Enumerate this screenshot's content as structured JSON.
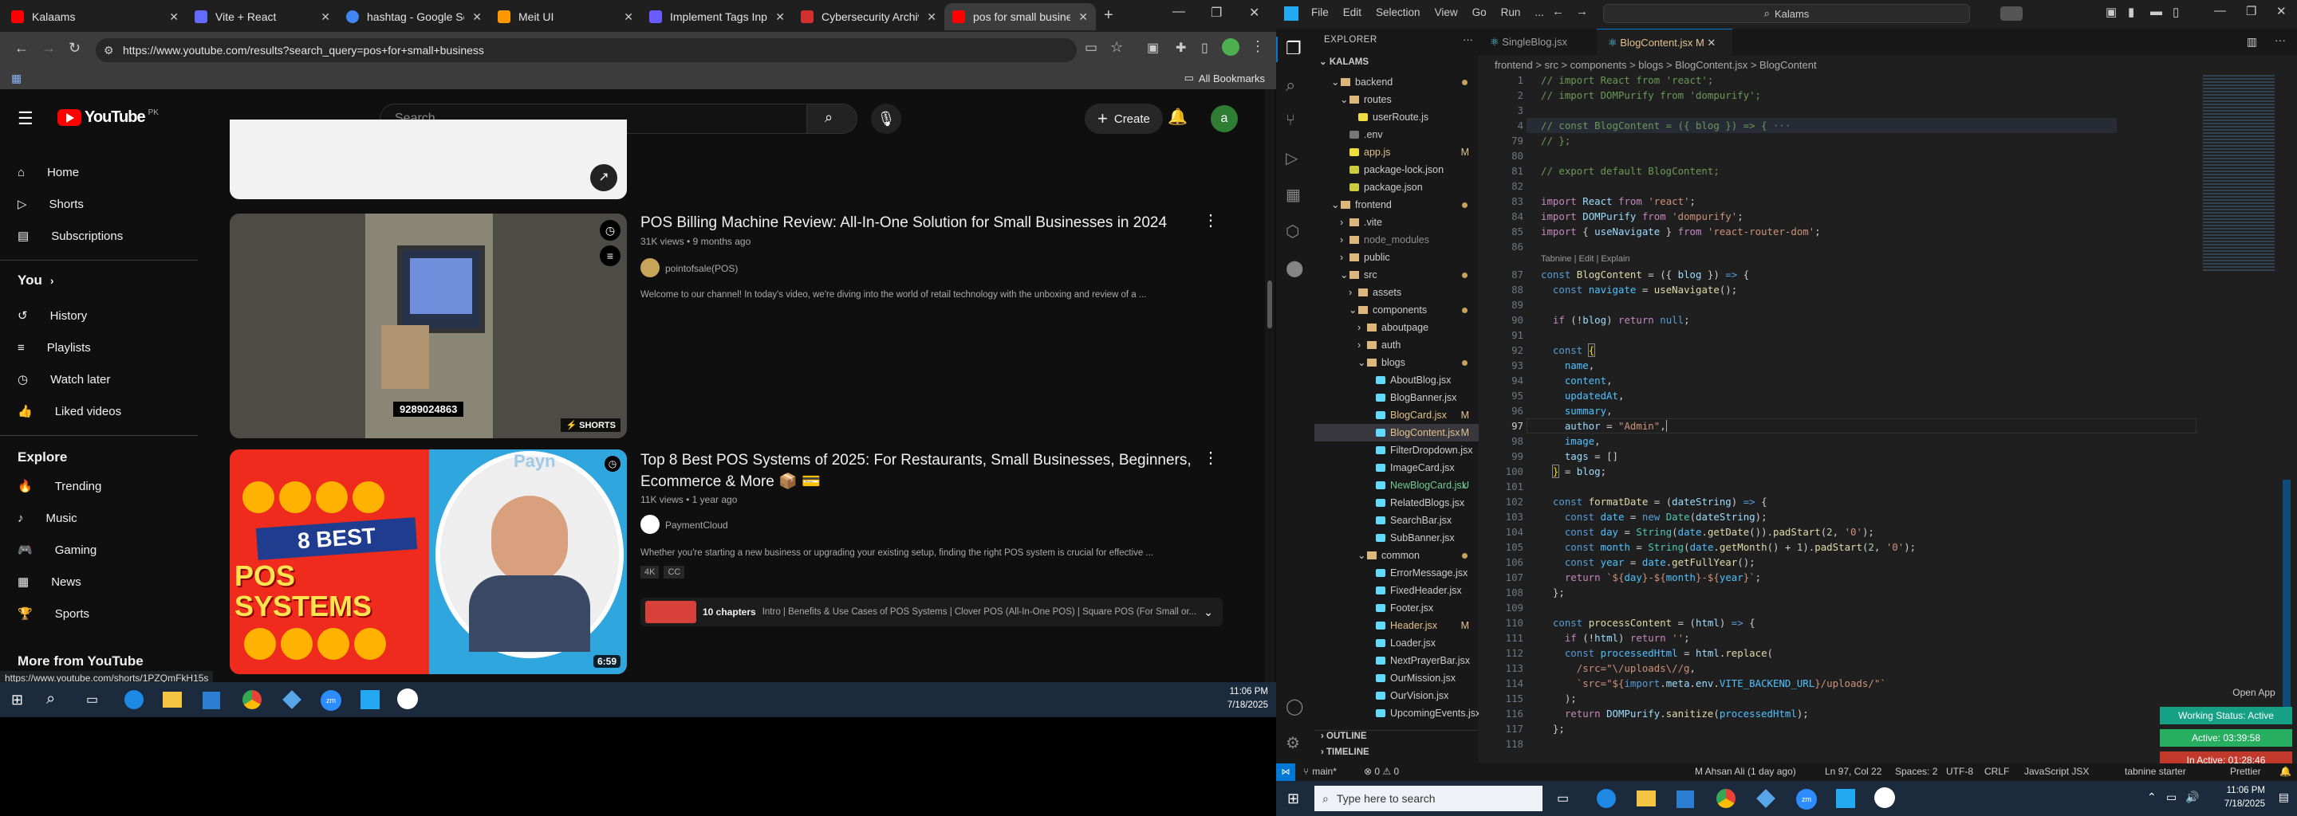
{
  "browser": {
    "tabs": [
      {
        "title": "Kalaams",
        "color": "#ff0000"
      },
      {
        "title": "Vite + React",
        "color": "#646cff"
      },
      {
        "title": "hashtag - Google Sear",
        "color": "#4285f4"
      },
      {
        "title": "Meit UI",
        "color": "#ff9800"
      },
      {
        "title": "Implement Tags Input",
        "color": "#6b5cff"
      },
      {
        "title": "Cybersecurity Archive",
        "color": "#d32f2f"
      },
      {
        "title": "pos for small busines",
        "color": "#ff0000"
      }
    ],
    "url": "https://www.youtube.com/results?search_query=pos+for+small+business",
    "bookmarks_label": "All Bookmarks",
    "status_url": "https://www.youtube.com/shorts/1PZQmFkH15s"
  },
  "youtube": {
    "country": "PK",
    "logo": "YouTube",
    "search_placeholder": "Search",
    "create_label": "Create",
    "avatar": "a",
    "sidebar": {
      "main": [
        "Home",
        "Shorts",
        "Subscriptions"
      ],
      "you_heading": "You",
      "you_items": [
        "History",
        "Playlists",
        "Watch later",
        "Liked videos"
      ],
      "explore_heading": "Explore",
      "explore_items": [
        "Trending",
        "Music",
        "Gaming",
        "News",
        "Sports"
      ],
      "more_heading": "More from YouTube"
    },
    "videos": [
      {
        "title": "POS Billing Machine Review: All-In-One Solution for Small Businesses in 2024",
        "meta": "31K views • 9 months ago",
        "channel": "pointofsale(POS)",
        "description": "Welcome to our channel! In today's video, we're diving into the world of retail technology with the unboxing and review of a ...",
        "phone": "9289024863",
        "badge": "SHORTS"
      },
      {
        "title": "Top 8 Best POS Systems of 2025: For Restaurants, Small Businesses, Beginners, Ecommerce & More 📦 💳",
        "meta": "11K views • 1 year ago",
        "channel": "PaymentCloud",
        "description": "Whether you're starting a new business or upgrading your existing setup, finding the right POS system is crucial for effective ...",
        "tags": [
          "4K",
          "CC"
        ],
        "chapters_label": "10 chapters",
        "chapters_text": "Intro | Benefits & Use Cases of POS Systems | Clover POS (All-In-One POS) | Square POS (For Small or...",
        "duration": "6:59",
        "thumb_line1": "8 BEST",
        "thumb_line2": "POS SYSTEMS",
        "thumb_brand": "Payn"
      }
    ]
  },
  "taskbar_left": {
    "time": "11:06 PM",
    "date": "7/18/2025"
  },
  "vscode": {
    "title_menu": [
      "File",
      "Edit",
      "Selection",
      "View",
      "Go",
      "Run",
      "..."
    ],
    "search": "Kalams",
    "explorer_label": "EXPLORER",
    "root": "KALAMS",
    "tree": [
      {
        "name": "backend",
        "type": "folder",
        "open": true,
        "level": 1,
        "status": "dot-yellow"
      },
      {
        "name": "routes",
        "type": "folder",
        "open": true,
        "level": 2
      },
      {
        "name": "userRoute.js",
        "type": "file",
        "level": 3
      },
      {
        "name": ".env",
        "type": "file",
        "level": 2
      },
      {
        "name": "app.js",
        "type": "file",
        "level": 2,
        "status": "M"
      },
      {
        "name": "package-lock.json",
        "type": "file",
        "level": 2
      },
      {
        "name": "package.json",
        "type": "file",
        "level": 2
      },
      {
        "name": "frontend",
        "type": "folder",
        "open": true,
        "level": 1,
        "status": "dot-yellow"
      },
      {
        "name": ".vite",
        "type": "folder",
        "open": false,
        "level": 2
      },
      {
        "name": "node_modules",
        "type": "folder",
        "open": false,
        "level": 2,
        "dim": true
      },
      {
        "name": "public",
        "type": "folder",
        "open": false,
        "level": 2
      },
      {
        "name": "src",
        "type": "folder",
        "open": true,
        "level": 2,
        "status": "dot-yellow"
      },
      {
        "name": "assets",
        "type": "folder",
        "open": false,
        "level": 3
      },
      {
        "name": "components",
        "type": "folder",
        "open": true,
        "level": 3,
        "status": "dot-yellow"
      },
      {
        "name": "aboutpage",
        "type": "folder",
        "open": false,
        "level": 4
      },
      {
        "name": "auth",
        "type": "folder",
        "open": false,
        "level": 4
      },
      {
        "name": "blogs",
        "type": "folder",
        "open": true,
        "level": 4,
        "status": "dot-yellow"
      },
      {
        "name": "AboutBlog.jsx",
        "type": "file",
        "level": 5
      },
      {
        "name": "BlogBanner.jsx",
        "type": "file",
        "level": 5
      },
      {
        "name": "BlogCard.jsx",
        "type": "file",
        "level": 5,
        "status": "M"
      },
      {
        "name": "BlogContent.jsx",
        "type": "file",
        "level": 5,
        "status": "M",
        "selected": true
      },
      {
        "name": "FilterDropdown.jsx",
        "type": "file",
        "level": 5
      },
      {
        "name": "ImageCard.jsx",
        "type": "file",
        "level": 5
      },
      {
        "name": "NewBlogCard.jsx",
        "type": "file",
        "level": 5,
        "status": "U"
      },
      {
        "name": "RelatedBlogs.jsx",
        "type": "file",
        "level": 5
      },
      {
        "name": "SearchBar.jsx",
        "type": "file",
        "level": 5
      },
      {
        "name": "SubBanner.jsx",
        "type": "file",
        "level": 5
      },
      {
        "name": "common",
        "type": "folder",
        "open": true,
        "level": 4,
        "status": "dot-yellow"
      },
      {
        "name": "ErrorMessage.jsx",
        "type": "file",
        "level": 5
      },
      {
        "name": "FixedHeader.jsx",
        "type": "file",
        "level": 5
      },
      {
        "name": "Footer.jsx",
        "type": "file",
        "level": 5
      },
      {
        "name": "Header.jsx",
        "type": "file",
        "level": 5,
        "status": "M"
      },
      {
        "name": "Loader.jsx",
        "type": "file",
        "level": 5
      },
      {
        "name": "NextPrayerBar.jsx",
        "type": "file",
        "level": 5
      },
      {
        "name": "OurMission.jsx",
        "type": "file",
        "level": 5
      },
      {
        "name": "OurVision.jsx",
        "type": "file",
        "level": 5
      },
      {
        "name": "UpcomingEvents.jsx",
        "type": "file",
        "level": 5
      }
    ],
    "outline_label": "OUTLINE",
    "timeline_label": "TIMELINE",
    "tabs": [
      {
        "name": "SingleBlog.jsx",
        "active": false
      },
      {
        "name": "BlogContent.jsx M",
        "active": true
      }
    ],
    "breadcrumb": "frontend > src > components > blogs > BlogContent.jsx > BlogContent",
    "codelens": "Tabnine | Edit | Explain",
    "status_bar": {
      "branch": "main*",
      "problems": "⊗ 0 ⚠ 0",
      "author": "M Ahsan Ali (1 day ago)",
      "position": "Ln 97, Col 22",
      "spaces": "Spaces: 2",
      "encoding": "UTF-8",
      "eol": "CRLF",
      "language": "JavaScript JSX",
      "tabnine": "tabnine starter",
      "prettier": "Prettier"
    },
    "badges": {
      "open_app": "Open App",
      "working": "Working Status: Active",
      "active": "Active: 03:39:58",
      "inactive": "In Active: 01:28:46"
    }
  },
  "taskbar_right": {
    "search_placeholder": "Type here to search",
    "time": "11:06 PM",
    "date": "7/18/2025"
  }
}
